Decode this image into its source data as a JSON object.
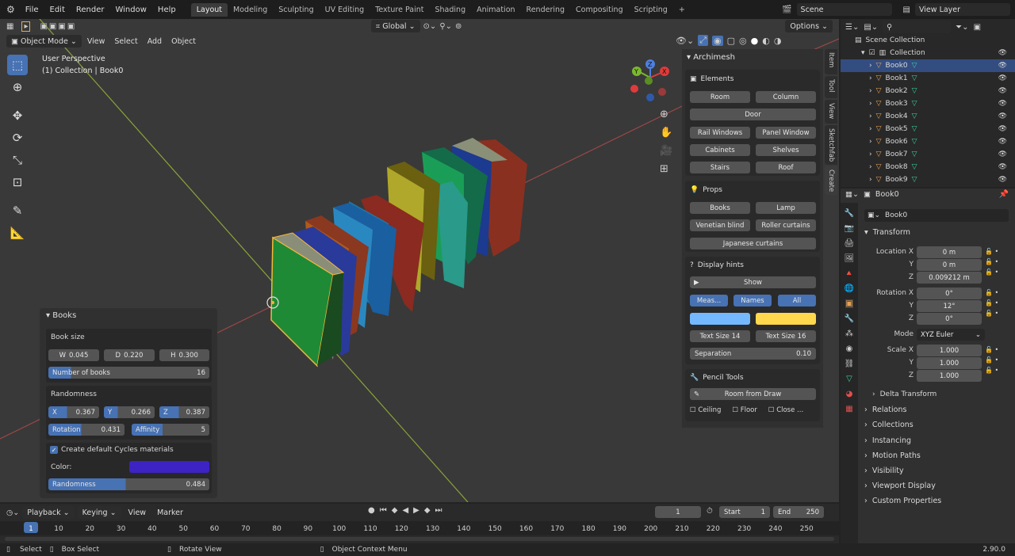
{
  "menubar": {
    "menus": [
      "File",
      "Edit",
      "Render",
      "Window",
      "Help"
    ],
    "workspace_tabs": [
      "Layout",
      "Modeling",
      "Sculpting",
      "UV Editing",
      "Texture Paint",
      "Shading",
      "Animation",
      "Rendering",
      "Compositing",
      "Scripting"
    ],
    "active_tab": "Layout",
    "scene": "Scene",
    "view_layer": "View Layer"
  },
  "viewport": {
    "mode": "Object Mode",
    "menus": [
      "View",
      "Select",
      "Add",
      "Object"
    ],
    "transform": "Global",
    "options": "Options",
    "overlay_title": "User Perspective",
    "overlay_subtitle": "(1) Collection | Book0",
    "gizmo_labels": [
      "Y",
      "X",
      "Z"
    ]
  },
  "npanel": {
    "addon": "Archimesh",
    "tabs": [
      "Item",
      "Tool",
      "View",
      "Sketchfab",
      "Create"
    ],
    "elements_title": "Elements",
    "elements": [
      "Room",
      "Column",
      "Door",
      "Rail Windows",
      "Panel Window",
      "Cabinets",
      "Shelves",
      "Stairs",
      "Roof"
    ],
    "props_title": "Props",
    "props": [
      "Books",
      "Lamp",
      "Venetian blind",
      "Roller curtains",
      "Japanese curtains"
    ],
    "hints_title": "Display hints",
    "show": "Show",
    "hint_toggles": [
      "Meas...",
      "Names",
      "All"
    ],
    "text_size_a": "Text Size  14",
    "text_size_b": "Text Size  16",
    "separation_label": "Separation",
    "separation_value": "0.10",
    "colors": [
      "#74b9ff",
      "#ffd84d"
    ],
    "pencil_title": "Pencil Tools",
    "room_from_draw": "Room from Draw",
    "checks": [
      "Ceiling",
      "Floor",
      "Close ..."
    ]
  },
  "operator": {
    "title": "Books",
    "size_title": "Book size",
    "size": [
      {
        "k": "W",
        "v": "0.045"
      },
      {
        "k": "D",
        "v": "0.220"
      },
      {
        "k": "H",
        "v": "0.300"
      }
    ],
    "num_books_label": "Number of books",
    "num_books": "16",
    "rand_title": "Randomness",
    "rand_xyz": [
      {
        "k": "X",
        "v": "0.367"
      },
      {
        "k": "Y",
        "v": "0.266"
      },
      {
        "k": "Z",
        "v": "0.387"
      }
    ],
    "rotation_label": "Rotation",
    "rotation": "0.431",
    "affinity_label": "Affinity",
    "affinity": "5",
    "cycles_label": "Create default Cycles materials",
    "color_label": "Color:",
    "color": "#3d22c4",
    "randomness_label": "Randomness",
    "randomness": "0.484"
  },
  "outliner": {
    "scene_collection": "Scene Collection",
    "collection": "Collection",
    "items": [
      "Book0",
      "Book1",
      "Book2",
      "Book3",
      "Book4",
      "Book5",
      "Book6",
      "Book7",
      "Book8",
      "Book9"
    ],
    "selected": "Book0"
  },
  "properties": {
    "object": "Book0",
    "name_field": "Book0",
    "transform_title": "Transform",
    "location": [
      {
        "k": "Location X",
        "v": "0 m"
      },
      {
        "k": "Y",
        "v": "0 m"
      },
      {
        "k": "Z",
        "v": "0.009212 m"
      }
    ],
    "rotation": [
      {
        "k": "Rotation X",
        "v": "0°"
      },
      {
        "k": "Y",
        "v": "12°"
      },
      {
        "k": "Z",
        "v": "0°"
      }
    ],
    "mode_label": "Mode",
    "mode": "XYZ Euler",
    "scale": [
      {
        "k": "Scale X",
        "v": "1.000"
      },
      {
        "k": "Y",
        "v": "1.000"
      },
      {
        "k": "Z",
        "v": "1.000"
      }
    ],
    "delta": "Delta Transform",
    "sections": [
      "Relations",
      "Collections",
      "Instancing",
      "Motion Paths",
      "Visibility",
      "Viewport Display",
      "Custom Properties"
    ]
  },
  "timeline": {
    "menus": [
      "Playback",
      "Keying",
      "View",
      "Marker"
    ],
    "current_frame": "1",
    "start_label": "Start",
    "start": "1",
    "end_label": "End",
    "end": "250",
    "ticks": [
      "1",
      "10",
      "20",
      "30",
      "40",
      "50",
      "60",
      "70",
      "80",
      "90",
      "100",
      "110",
      "120",
      "130",
      "140",
      "150",
      "160",
      "170",
      "180",
      "190",
      "200",
      "210",
      "220",
      "230",
      "240",
      "250"
    ]
  },
  "statusbar": {
    "select": "Select",
    "box_select": "Box Select",
    "rotate_view": "Rotate View",
    "context_menu": "Object Context Menu",
    "version": "2.90.0"
  }
}
